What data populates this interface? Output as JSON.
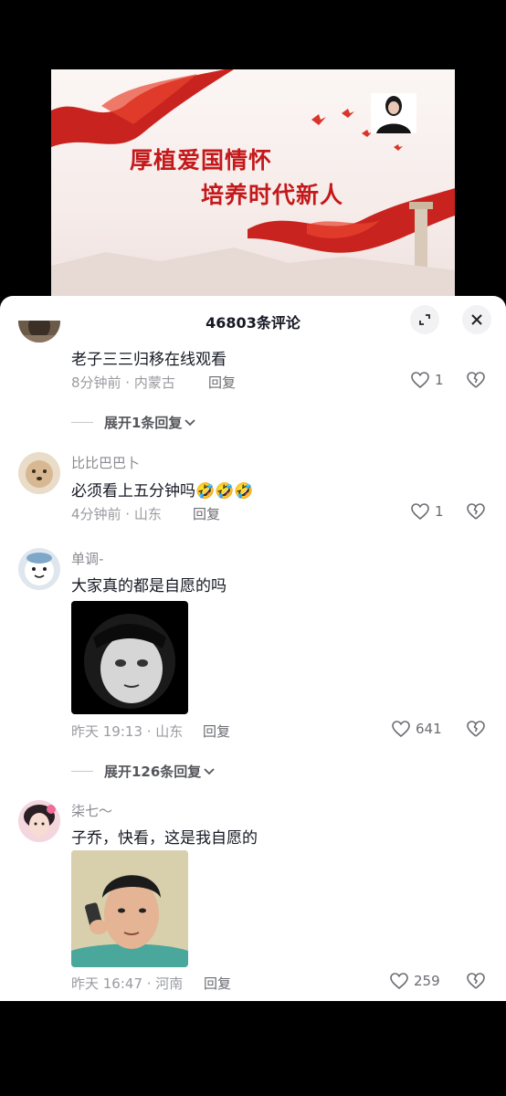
{
  "video": {
    "title_line1": "厚植爱国情怀",
    "title_line2": "培养时代新人"
  },
  "sheet": {
    "count_title": "46803条评论",
    "expand_icon": "expand-icon",
    "close_icon": "close-icon"
  },
  "comments": [
    {
      "text": "老子三三归移在线观看",
      "time": "8分钟前 · 内蒙古",
      "reply_label": "回复",
      "likes": "1",
      "expand_label": "展开1条回复"
    },
    {
      "username": "比比巴巴卜",
      "text": "必须看上五分钟吗🤣🤣🤣",
      "time": "4分钟前 · 山东",
      "reply_label": "回复",
      "likes": "1"
    },
    {
      "username": "单调-",
      "text": "大家真的都是自愿的吗",
      "time": "昨天 19:13 · 山东",
      "reply_label": "回复",
      "likes": "641",
      "expand_label": "展开126条回复"
    },
    {
      "username": "柒七～",
      "text": "子乔，快看，这是我自愿的",
      "time": "昨天 16:47 · 河南",
      "reply_label": "回复",
      "likes": "259"
    }
  ],
  "colors": {
    "accent_red": "#c4191b",
    "text_primary": "#161823",
    "text_secondary": "#9a9ba0"
  }
}
